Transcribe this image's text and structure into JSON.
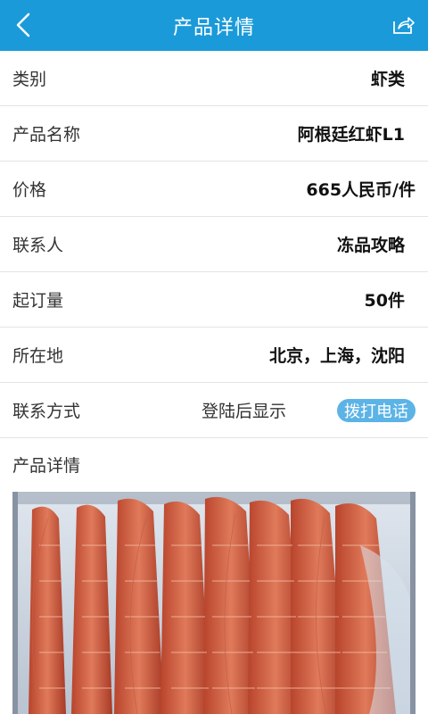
{
  "header": {
    "title": "产品详情",
    "back_icon": "chevron-left-icon",
    "share_icon": "share-icon",
    "bg_color": "#1a9ad9"
  },
  "details": {
    "category_label": "类别",
    "category_value": "虾类",
    "name_label": "产品名称",
    "name_value": "阿根廷红虾L1",
    "price_label": "价格",
    "price_value": "665人民币/件",
    "contact_person_label": "联系人",
    "contact_person_value": "冻品攻略",
    "moq_label": "起订量",
    "moq_value": "50件",
    "location_label": "所在地",
    "location_value": "北京，上海，沈阳",
    "contact_method_label": "联系方式",
    "contact_method_hint": "登陆后显示",
    "call_button_label": "拨打电话",
    "product_details_label": "产品详情"
  },
  "image": {
    "subject": "frozen red shrimp in box"
  }
}
